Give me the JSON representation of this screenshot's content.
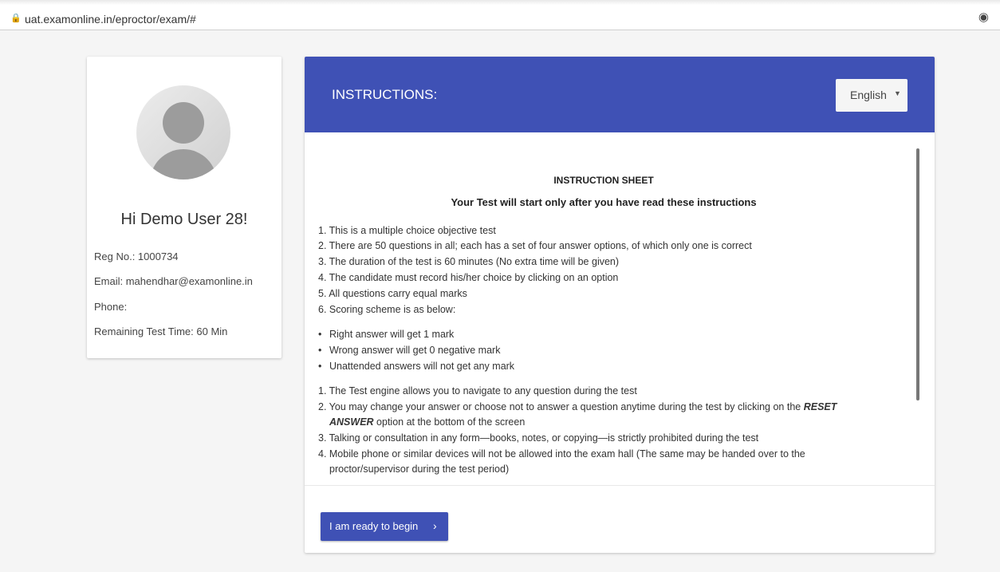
{
  "browser": {
    "url": "uat.examonline.in/eproctor/exam/#"
  },
  "profile": {
    "greeting": "Hi Demo User 28!",
    "reg_no": "Reg No.: 1000734",
    "email": "Email: mahendhar@examonline.in",
    "phone": "Phone:",
    "remaining": "Remaining Test Time: 60 Min"
  },
  "instructions": {
    "title": "INSTRUCTIONS:",
    "language": "English",
    "sheet_title": "INSTRUCTION SHEET",
    "sheet_subtitle": "Your Test will start only after you have read these instructions",
    "list1": [
      "1. This is a multiple choice objective test",
      "2. There are 50 questions in all; each has a set of four answer options, of which only one is correct",
      "3. The duration of the test is 60 minutes  (No extra time will be given)",
      "4. The candidate must record his/her choice by clicking on an option",
      "5. All questions carry equal marks",
      "6. Scoring scheme is as below:"
    ],
    "bullets": [
      "Right answer will get 1 mark",
      "Wrong answer will get 0 negative mark",
      "Unattended answers will not get any mark"
    ],
    "list2_1": "1. The Test engine allows you to navigate to any question during the test",
    "list2_2a": "2. You may change your answer or choose not to answer a question anytime during the test by clicking on the ",
    "list2_2b": "RESET",
    "list2_2c": "ANSWER",
    "list2_2d": " option at the bottom of the screen",
    "list2_3": "3. Talking or consultation in any form—books, notes, or copying—is strictly prohibited during the test",
    "list2_4a": "4. Mobile phone or similar devices will not be allowed into the exam hall (The same may be handed over to the",
    "list2_4b": "proctor/supervisor during the test period)"
  },
  "footer": {
    "begin_label": "I am ready to begin"
  }
}
